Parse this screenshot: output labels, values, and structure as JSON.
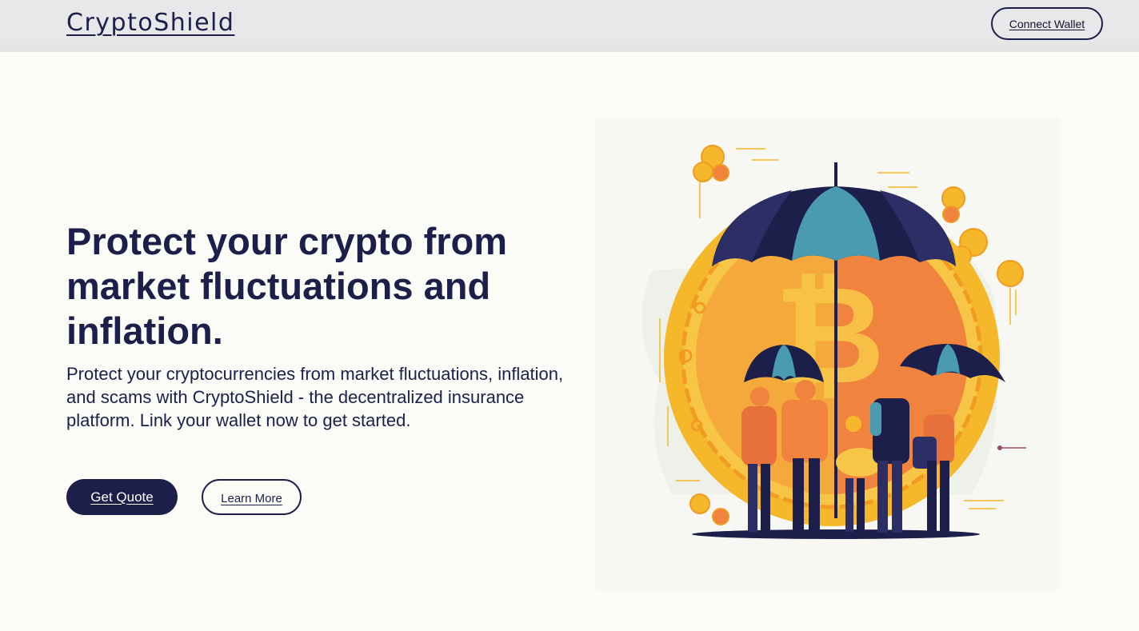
{
  "header": {
    "brand": "CryptoShield",
    "connect_wallet_label": "Connect Wallet"
  },
  "hero": {
    "headline": "Protect your crypto from market fluctuations and inflation.",
    "description": "Protect your cryptocurrencies from market fluctuations, inflation, and scams with CryptoShield - the decentralized insurance platform. Link your wallet now to get started.",
    "primary_button_label": "Get Quote",
    "secondary_button_label": "Learn More",
    "illustration": "people-under-umbrellas-bitcoin-illustration"
  },
  "colors": {
    "navy": "#1b1f4a",
    "background": "#fbfcf7",
    "header_bg": "#e8e8ea",
    "coin_gold": "#f6b82b",
    "coin_orange": "#f0843f",
    "umbrella_teal": "#4a9bb0"
  }
}
